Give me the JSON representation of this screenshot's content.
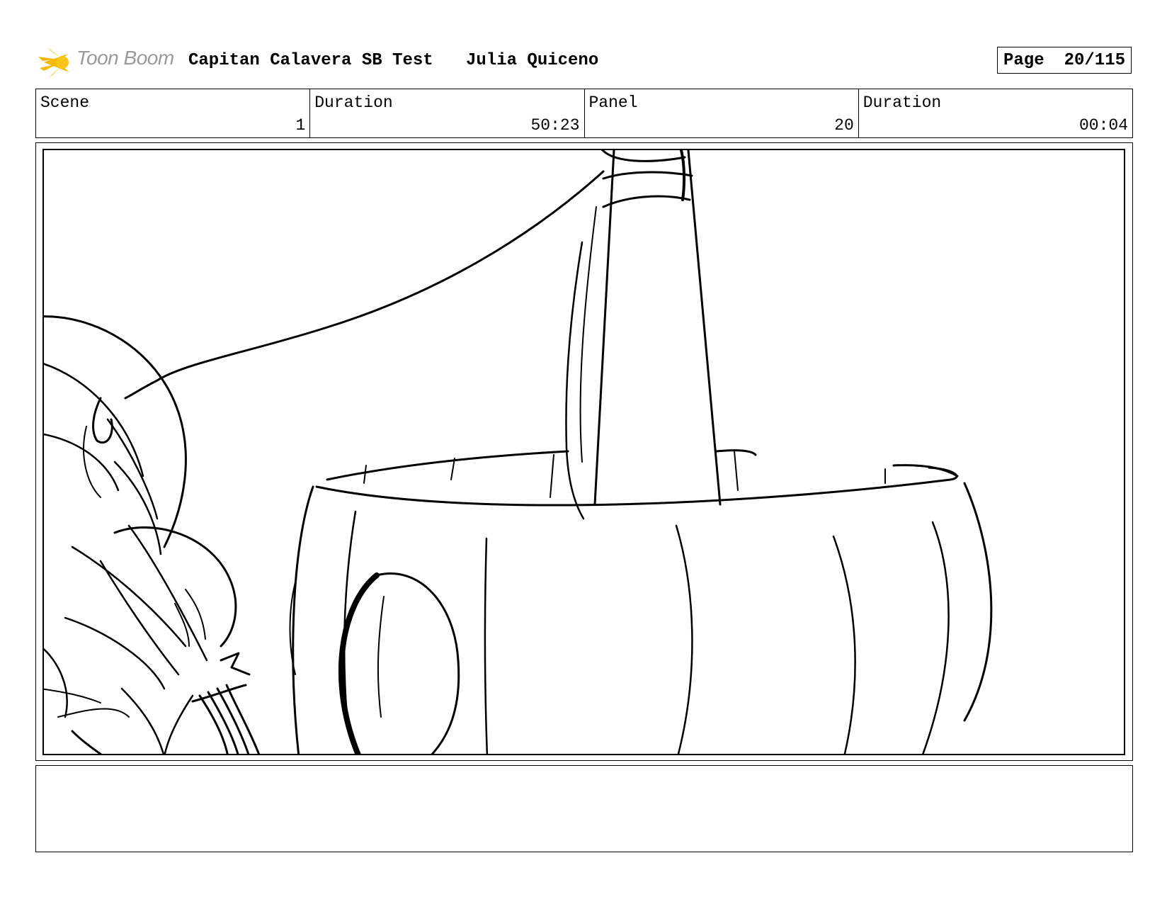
{
  "header": {
    "logo_text": "Toon Boom",
    "project_title": "Capitan Calavera SB Test",
    "author": "Julia Quiceno",
    "page_label": "Page",
    "page_value": "20/115"
  },
  "info": [
    {
      "label": "Scene",
      "value": "1"
    },
    {
      "label": "Duration",
      "value": "50:23"
    },
    {
      "label": "Panel",
      "value": "20"
    },
    {
      "label": "Duration",
      "value": "00:04"
    }
  ],
  "colors": {
    "logo_star": "#f5b800",
    "logo_text": "#9a9a9a",
    "line": "#000000"
  },
  "icons": {
    "logo": "toon-boom-star-icon"
  },
  "notes": ""
}
